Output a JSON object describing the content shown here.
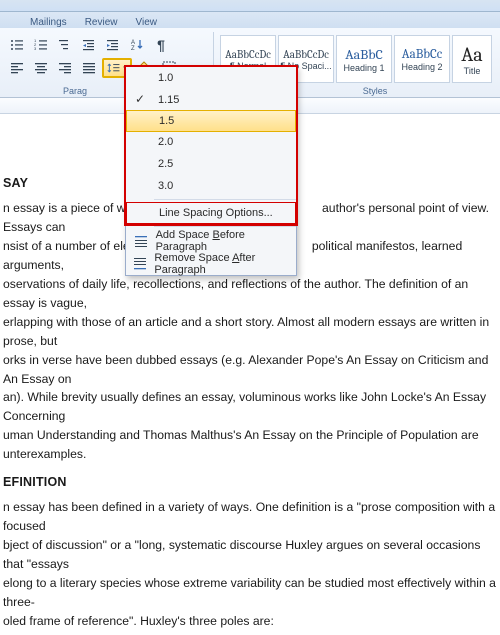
{
  "tabs": {
    "mailings": "Mailings",
    "review": "Review",
    "view": "View"
  },
  "groups": {
    "paragraph": "Parag",
    "styles": "Styles"
  },
  "styles": [
    {
      "preview": "AaBbCcDc",
      "name": "¶ Normal"
    },
    {
      "preview": "AaBbCcDc",
      "name": "¶ No Spaci..."
    },
    {
      "preview": "AaBbC",
      "name": "Heading 1"
    },
    {
      "preview": "AaBbCc",
      "name": "Heading 2"
    },
    {
      "preview": "Aa",
      "name": "Title"
    }
  ],
  "dropdown": {
    "values": [
      "1.0",
      "1.15",
      "1.5",
      "2.0",
      "2.5",
      "3.0"
    ],
    "checked": "1.15",
    "hover": "1.5",
    "lso": "Line Spacing Options...",
    "addBefore_pre": "Add Space ",
    "addBefore_u": "B",
    "addBefore_post": "efore Paragraph",
    "removeAfter_pre": "Remove Space ",
    "removeAfter_u": "A",
    "removeAfter_post": "fter Paragraph"
  },
  "doc": {
    "h1": "SAY",
    "p1_a": "n essay is a piece of writing",
    "p1_b": "author's personal point of view. Essays can",
    "p2_a": "nsist of a number of elem",
    "p2_b": "political manifestos, learned arguments,",
    "p3": "oservations of daily life, recollections, and reflections of the author. The definition of an essay is vague,",
    "p4": "erlapping with those of an article  and a short story. Almost all modern essays are written in prose, but",
    "p5": "orks in verse have been dubbed essays (e.g. Alexander Pope's An Essay on Criticism and An Essay on",
    "p6": "an). While brevity usually defines an essay, voluminous works like John Locke's An Essay Concerning",
    "p7": "uman Understanding and Thomas Malthus's An Essay on the Principle of Population are",
    "p8": "unterexamples.",
    "h2": "EFINITION",
    "p9": "n essay has been defined in a variety of ways. One definition is a \"prose composition with a focused",
    "p10": "bject of discussion\" or a \"long, systematic discourse Huxley argues on several occasions that \"essays",
    "p11": "elong to a literary species whose extreme variability can be studied most effectively within a three-",
    "p12": "oled frame of reference\". Huxley's three poles are:"
  }
}
